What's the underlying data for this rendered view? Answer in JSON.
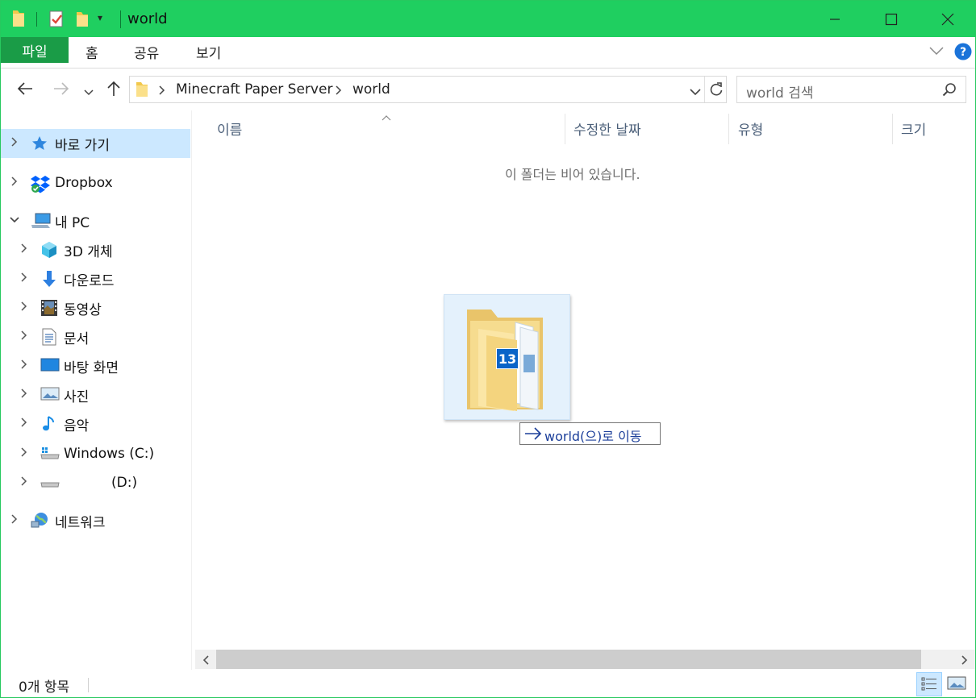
{
  "window": {
    "title": "world",
    "accent": "#1fcf60"
  },
  "ribbon": {
    "tabs": [
      "파일",
      "홈",
      "공유",
      "보기"
    ]
  },
  "address": {
    "breadcrumb": [
      "Minecraft Paper Server",
      "world"
    ]
  },
  "search": {
    "placeholder": "world 검색"
  },
  "sidebar": {
    "items": [
      {
        "label": "바로 가기",
        "icon": "star-icon"
      },
      {
        "label": "Dropbox",
        "icon": "dropbox-icon"
      },
      {
        "label": "내 PC",
        "icon": "computer-icon"
      },
      {
        "label": "3D 개체",
        "icon": "cube-icon"
      },
      {
        "label": "다운로드",
        "icon": "download-icon"
      },
      {
        "label": "동영상",
        "icon": "video-icon"
      },
      {
        "label": "문서",
        "icon": "document-icon"
      },
      {
        "label": "바탕 화면",
        "icon": "desktop-icon"
      },
      {
        "label": "사진",
        "icon": "picture-icon"
      },
      {
        "label": "음악",
        "icon": "music-icon"
      },
      {
        "label": "Windows (C:)",
        "icon": "drive-icon"
      },
      {
        "label": "(D:)",
        "icon": "drive-icon"
      },
      {
        "label": "네트워크",
        "icon": "network-icon"
      }
    ]
  },
  "content": {
    "columns": [
      "이름",
      "수정한 날짜",
      "유형",
      "크기"
    ],
    "empty_message": "이 폴더는 비어 있습니다.",
    "drag": {
      "count": "13",
      "tooltip": "world(으)로 이동"
    }
  },
  "status": {
    "text": "0개 항목"
  }
}
